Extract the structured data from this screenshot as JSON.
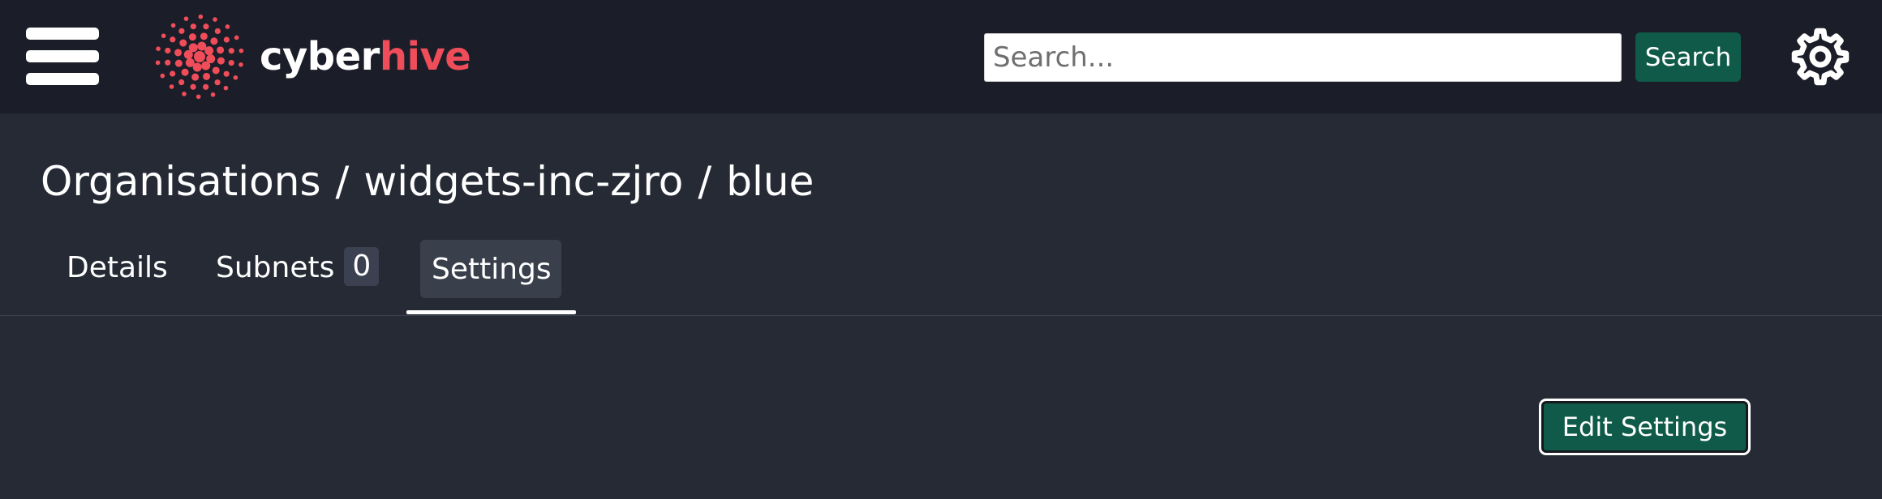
{
  "header": {
    "brand": {
      "part1": "cyber",
      "part2": "hive"
    },
    "search": {
      "placeholder": "Search...",
      "value": ""
    },
    "search_label": "Search",
    "icons": {
      "menu": "hamburger-menu-icon",
      "settings": "gear-icon",
      "logo": "cyberhive-logo-icon"
    }
  },
  "breadcrumb": {
    "items": [
      "Organisations",
      "widgets-inc-zjro",
      "blue"
    ],
    "separator": "/"
  },
  "tabs": [
    {
      "label": "Details",
      "active": false
    },
    {
      "label": "Subnets",
      "count": "0",
      "active": false
    },
    {
      "label": "Settings",
      "active": true
    }
  ],
  "actions": {
    "edit_settings": "Edit Settings"
  },
  "colors": {
    "topbar": "#1b1e28",
    "background": "#252a35",
    "brand_accent": "#f04d5a",
    "primary_button": "#0f5a48"
  }
}
